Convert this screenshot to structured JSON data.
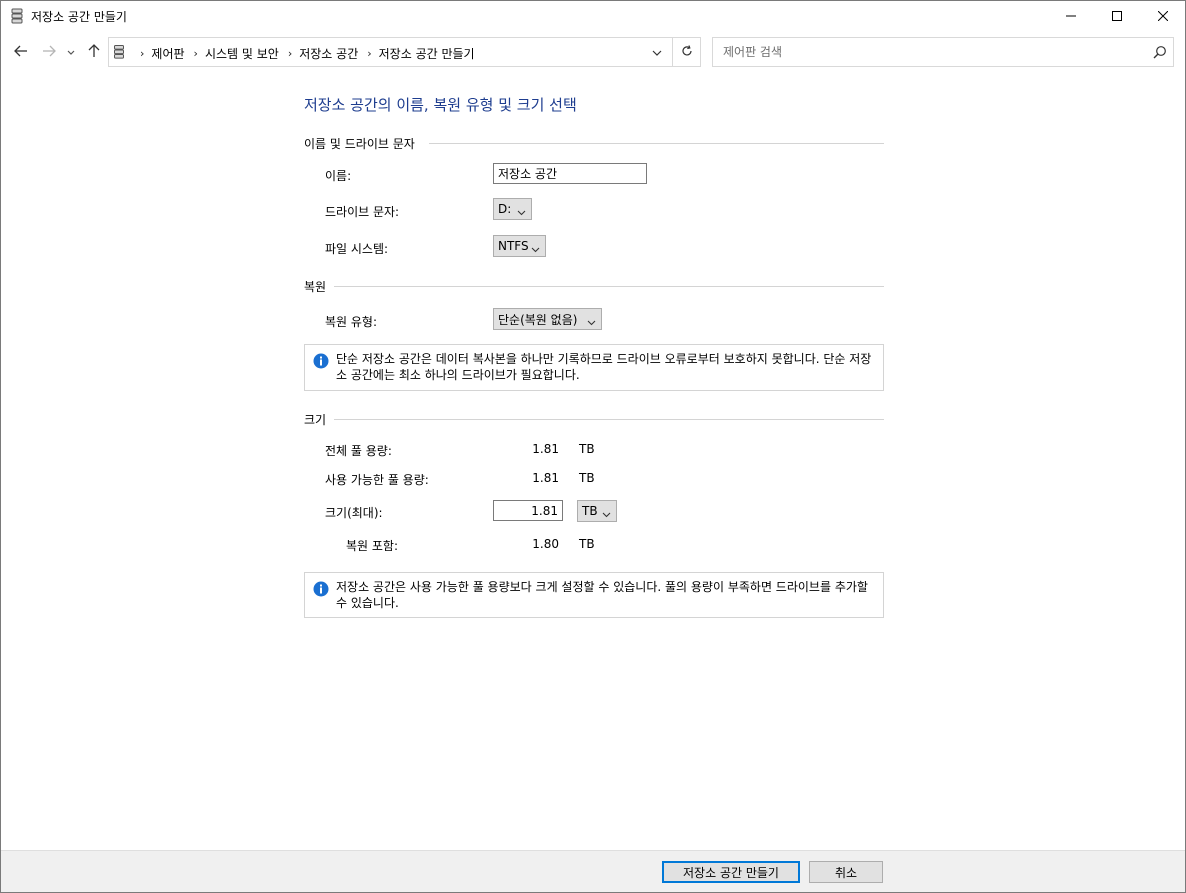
{
  "window": {
    "title": "저장소 공간 만들기"
  },
  "address": {
    "breadcrumbs": [
      "제어판",
      "시스템 및 보안",
      "저장소 공간",
      "저장소 공간 만들기"
    ]
  },
  "search": {
    "placeholder": "제어판 검색"
  },
  "page": {
    "title": "저장소 공간의 이름, 복원 유형 및 크기 선택"
  },
  "name_section": {
    "label": "이름 및 드라이브 문자",
    "name_label": "이름:",
    "name_value": "저장소 공간",
    "drive_letter_label": "드라이브 문자:",
    "drive_letter_value": "D:",
    "filesystem_label": "파일 시스템:",
    "filesystem_value": "NTFS"
  },
  "resiliency_section": {
    "label": "복원",
    "type_label": "복원 유형:",
    "type_value": "단순(복원 없음)",
    "info": "단순 저장소 공간은 데이터 복사본을 하나만 기록하므로 드라이브 오류로부터 보호하지 못합니다. 단순 저장소 공간에는 최소 하나의 드라이브가 필요합니다."
  },
  "size_section": {
    "label": "크기",
    "total_label": "전체 풀 용량:",
    "total_value": "1.81",
    "total_unit": "TB",
    "available_label": "사용 가능한 풀 용량:",
    "available_value": "1.81",
    "available_unit": "TB",
    "size_label": "크기(최대):",
    "size_value": "1.81",
    "size_unit": "TB",
    "including_label": "복원 포함:",
    "including_value": "1.80",
    "including_unit": "TB",
    "info": "저장소 공간은 사용 가능한 풀 용량보다 크게 설정할 수 있습니다. 풀의 용량이 부족하면 드라이브를 추가할 수 있습니다."
  },
  "footer": {
    "create_label": "저장소 공간 만들기",
    "cancel_label": "취소"
  },
  "colors": {
    "title_blue": "#1e3d8f",
    "info_blue": "#1a6fd1",
    "primary_border": "#0078d7"
  }
}
